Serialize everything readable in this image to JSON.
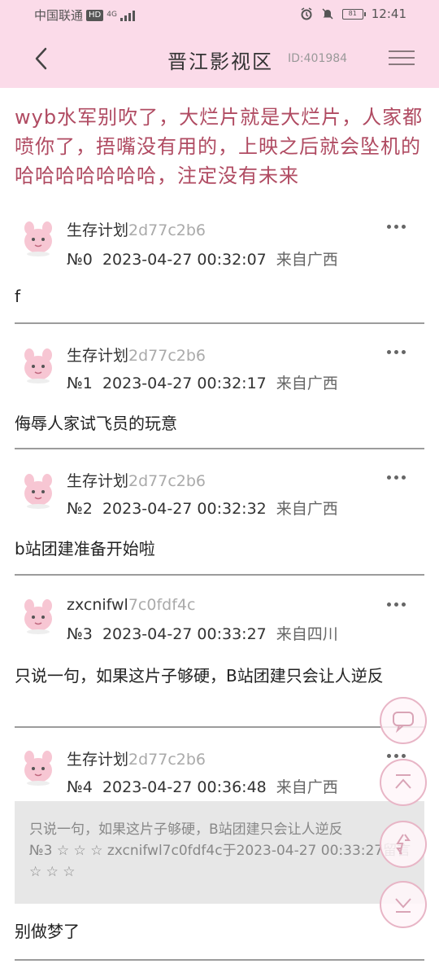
{
  "status_bar": {
    "carrier": "中国联通",
    "hd": "HD",
    "network": "4G",
    "battery": "81",
    "time": "12:41"
  },
  "header": {
    "title": "晋江影视区",
    "board_id": "ID:401984"
  },
  "thread_title": "wyb水军别吹了，大烂片就是大烂片，人家都喷你了，捂嘴没有用的，上映之后就会坠机的哈哈哈哈哈哈哈，注定没有未来",
  "posts": [
    {
      "user": "生存计划",
      "uid": "2d77c2b6",
      "floor": "№0",
      "time": "2023-04-27 00:32:07",
      "location": "来自广西",
      "content": "f"
    },
    {
      "user": "生存计划",
      "uid": "2d77c2b6",
      "floor": "№1",
      "time": "2023-04-27 00:32:17",
      "location": "来自广西",
      "content": "侮辱人家试飞员的玩意"
    },
    {
      "user": "生存计划",
      "uid": "2d77c2b6",
      "floor": "№2",
      "time": "2023-04-27 00:32:32",
      "location": "来自广西",
      "content": "b站团建准备开始啦"
    },
    {
      "user": "zxcnifwl",
      "uid": "7c0fdf4c",
      "floor": "№3",
      "time": "2023-04-27 00:33:27",
      "location": "来自四川",
      "content": "只说一句，如果这片子够硬，B站团建只会让人逆反"
    },
    {
      "user": "生存计划",
      "uid": "2d77c2b6",
      "floor": "№4",
      "time": "2023-04-27 00:36:48",
      "location": "来自广西",
      "content": "别做梦了",
      "quote": {
        "line1": "只说一句，如果这片子够硬，B站团建只会让人逆反",
        "line2": "№3 ☆ ☆ ☆ zxcnifwl7c0fdf4c于2023-04-27 00:33:27留言",
        "line3": "☆ ☆ ☆"
      }
    }
  ],
  "icons": {
    "back": "chevron-left-icon",
    "menu": "hamburger-icon",
    "more": "more-dots-icon",
    "comment": "comment-icon",
    "scroll_top": "arrow-up-icon",
    "refresh": "refresh-icon",
    "scroll_bottom": "arrow-down-icon"
  },
  "colors": {
    "header_bg": "#fbdbe9",
    "title_text": "#b04b62",
    "fab_border": "#e8b5c6"
  }
}
